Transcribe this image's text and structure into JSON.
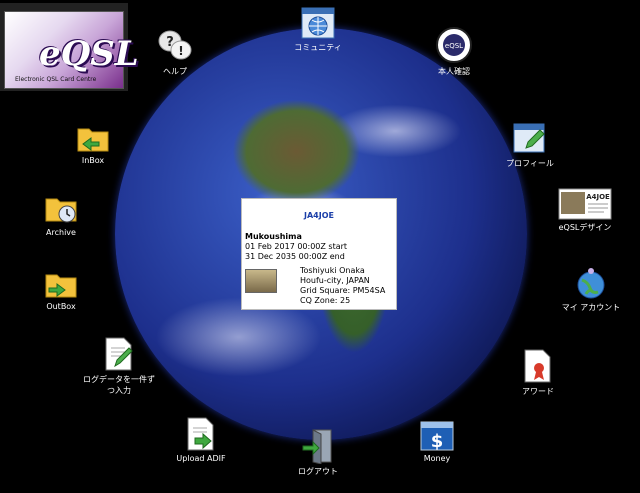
{
  "logo": {
    "text": "eQSL",
    "sub": "Electronic QSL Card Centre"
  },
  "card": {
    "callsign": "JA4JOE",
    "qth": "Mukoushima",
    "start": "01 Feb 2017 00:00Z start",
    "end": "31 Dec 2035 00:00Z end",
    "name": "Toshiyuki Onaka",
    "city": "Houfu-city, JAPAN",
    "grid": "Grid Square: PM54SA",
    "cq": "CQ Zone: 25"
  },
  "menu": {
    "help": "ヘルプ",
    "community": "コミュニティ",
    "identity": "本人確認",
    "inbox": "InBox",
    "profile": "プロフィール",
    "archive": "Archive",
    "design": "eQSLデザイン",
    "outbox": "OutBox",
    "account": "マイ アカウント",
    "log_entry_1": "ログデータを一件ず",
    "log_entry_2": "つ入力",
    "award": "アワード",
    "upload": "Upload ADIF",
    "logout": "ログアウト",
    "money": "Money"
  }
}
